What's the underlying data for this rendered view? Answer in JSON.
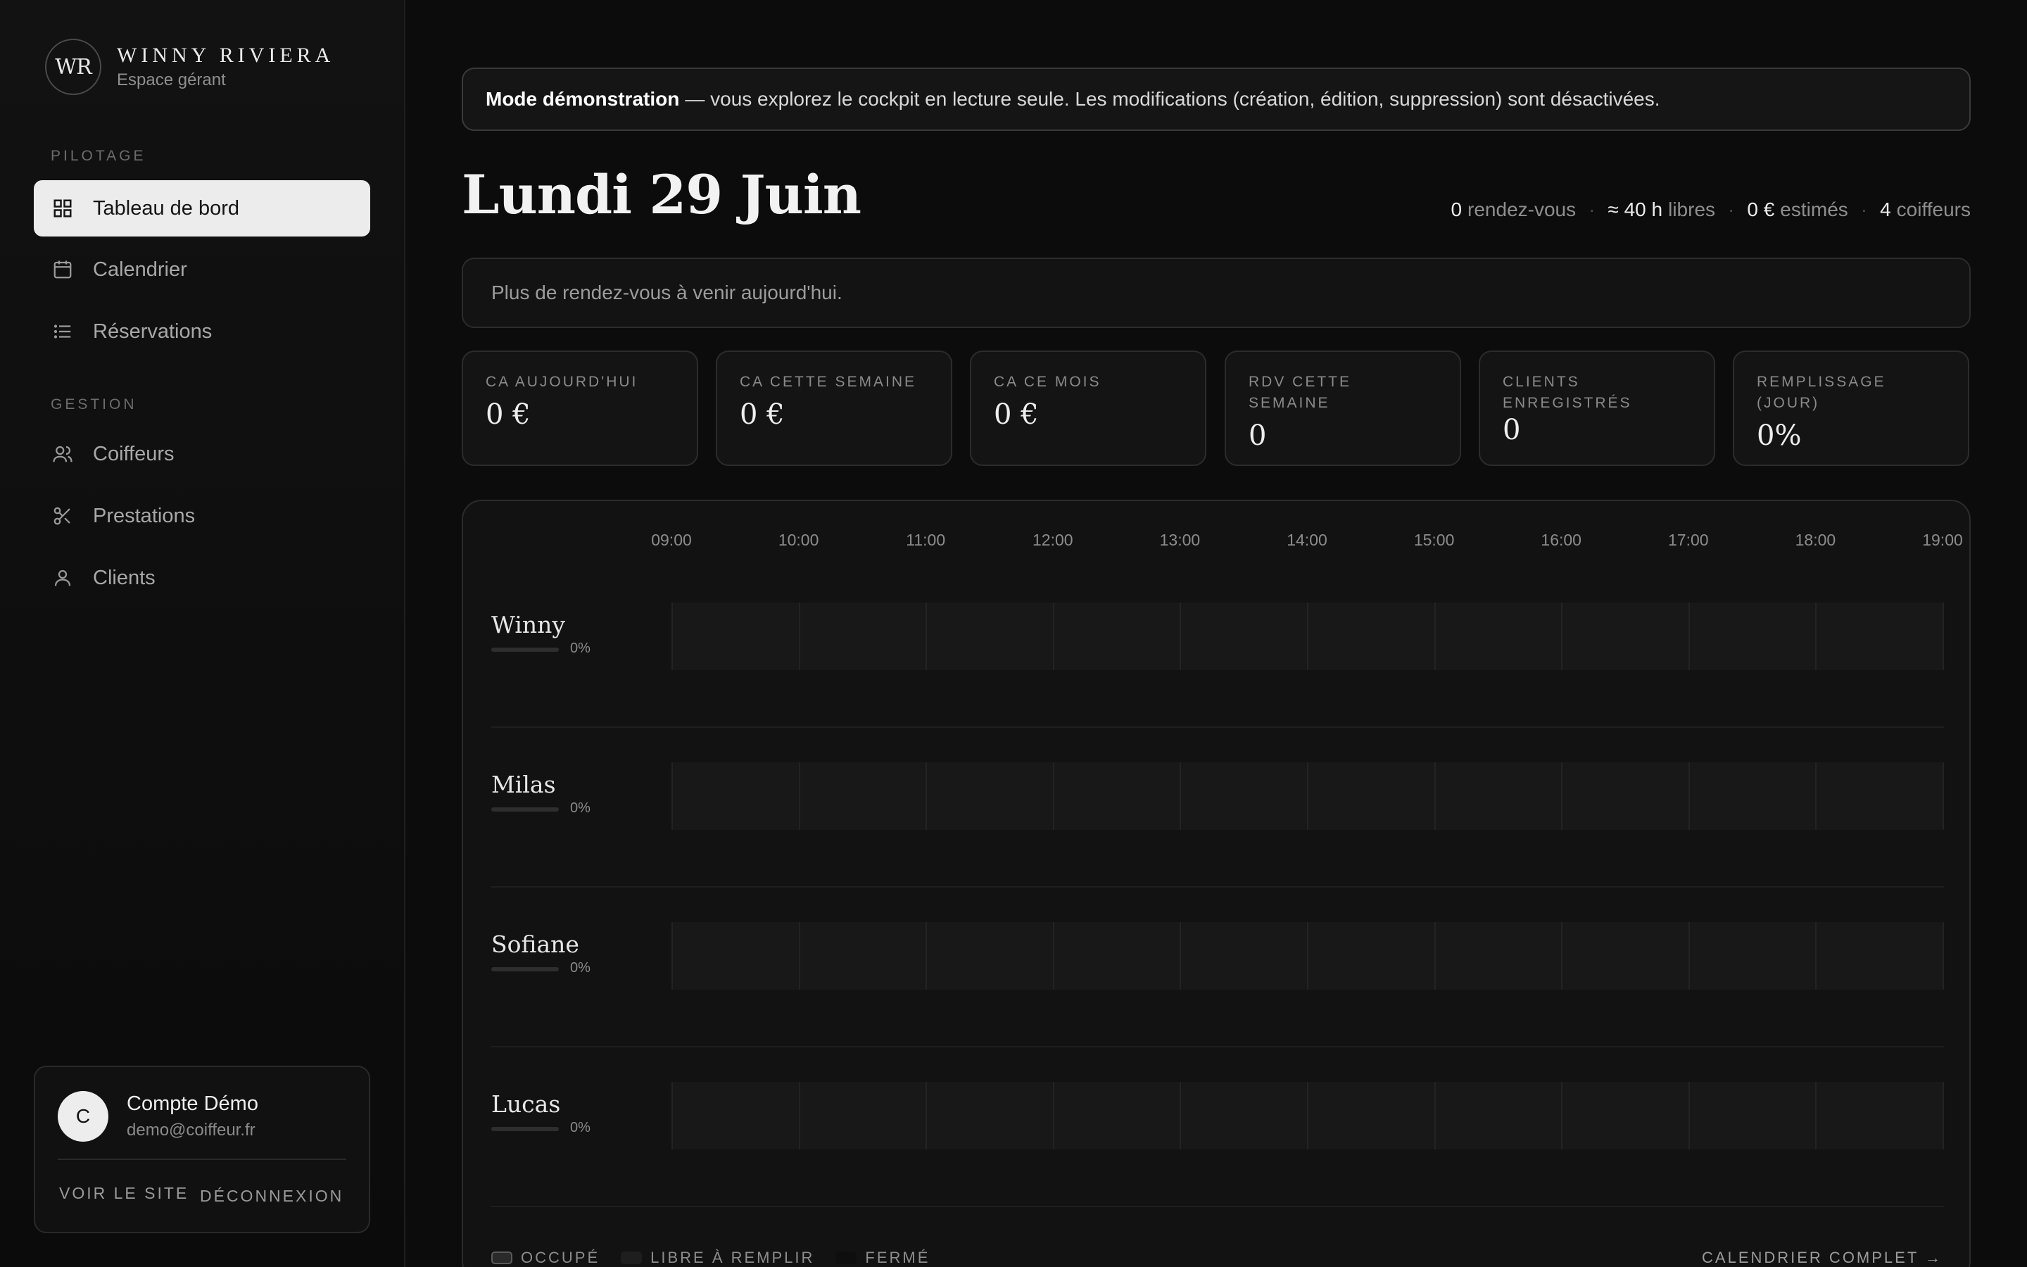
{
  "brand": {
    "logo": "WR",
    "name": "WINNY RIVIERA",
    "subtitle": "Espace gérant"
  },
  "sidebar": {
    "sections": [
      {
        "label": "PILOTAGE",
        "items": [
          {
            "label": "Tableau de bord",
            "icon": "grid-icon",
            "active": true
          },
          {
            "label": "Calendrier",
            "icon": "calendar-icon"
          },
          {
            "label": "Réservations",
            "icon": "list-icon"
          }
        ]
      },
      {
        "label": "GESTION",
        "items": [
          {
            "label": "Coiffeurs",
            "icon": "users-icon"
          },
          {
            "label": "Prestations",
            "icon": "scissors-icon"
          },
          {
            "label": "Clients",
            "icon": "user-icon"
          }
        ]
      }
    ],
    "account": {
      "initial": "C",
      "name": "Compte Démo",
      "email": "demo@coiffeur.fr",
      "view_site": "VOIR LE SITE",
      "logout": "DÉCONNEXION"
    }
  },
  "banner": {
    "strong": "Mode démonstration",
    "text": "— vous explorez le cockpit en lecture seule. Les modifications (création, édition, suppression) sont désactivées."
  },
  "header": {
    "title": "Lundi 29 Juin",
    "summary": [
      {
        "value": "0",
        "label": "rendez-vous"
      },
      {
        "value": "≈ 40 h",
        "label": "libres"
      },
      {
        "value": "0 €",
        "label": "estimés"
      },
      {
        "value": "4",
        "label": "coiffeurs"
      }
    ]
  },
  "notice": "Plus de rendez-vous à venir aujourd'hui.",
  "kpis": [
    {
      "label": "CA AUJOURD'HUI",
      "value": "0 €"
    },
    {
      "label": "CA CETTE SEMAINE",
      "value": "0 €"
    },
    {
      "label": "CA CE MOIS",
      "value": "0 €"
    },
    {
      "label": "RDV CETTE SEMAINE",
      "value": "0"
    },
    {
      "label": "CLIENTS ENREGISTRÉS",
      "value": "0"
    },
    {
      "label": "REMPLISSAGE (JOUR)",
      "value": "0%"
    }
  ],
  "schedule": {
    "hours": [
      "09:00",
      "10:00",
      "11:00",
      "12:00",
      "13:00",
      "14:00",
      "15:00",
      "16:00",
      "17:00",
      "18:00",
      "19:00"
    ],
    "rows": [
      {
        "name": "Winny",
        "fill_pct": "0%",
        "fill": 0
      },
      {
        "name": "Milas",
        "fill_pct": "0%",
        "fill": 0
      },
      {
        "name": "Sofiane",
        "fill_pct": "0%",
        "fill": 0
      },
      {
        "name": "Lucas",
        "fill_pct": "0%",
        "fill": 0
      }
    ],
    "legend": {
      "occupied": "OCCUPÉ",
      "free": "LIBRE À REMPLIR",
      "closed": "FERMÉ"
    },
    "full_calendar": "CALENDRIER COMPLET →"
  },
  "colors": {
    "background": "#0c0c0c",
    "active_nav": "#ececec",
    "card_border": "#2c2c2c"
  }
}
